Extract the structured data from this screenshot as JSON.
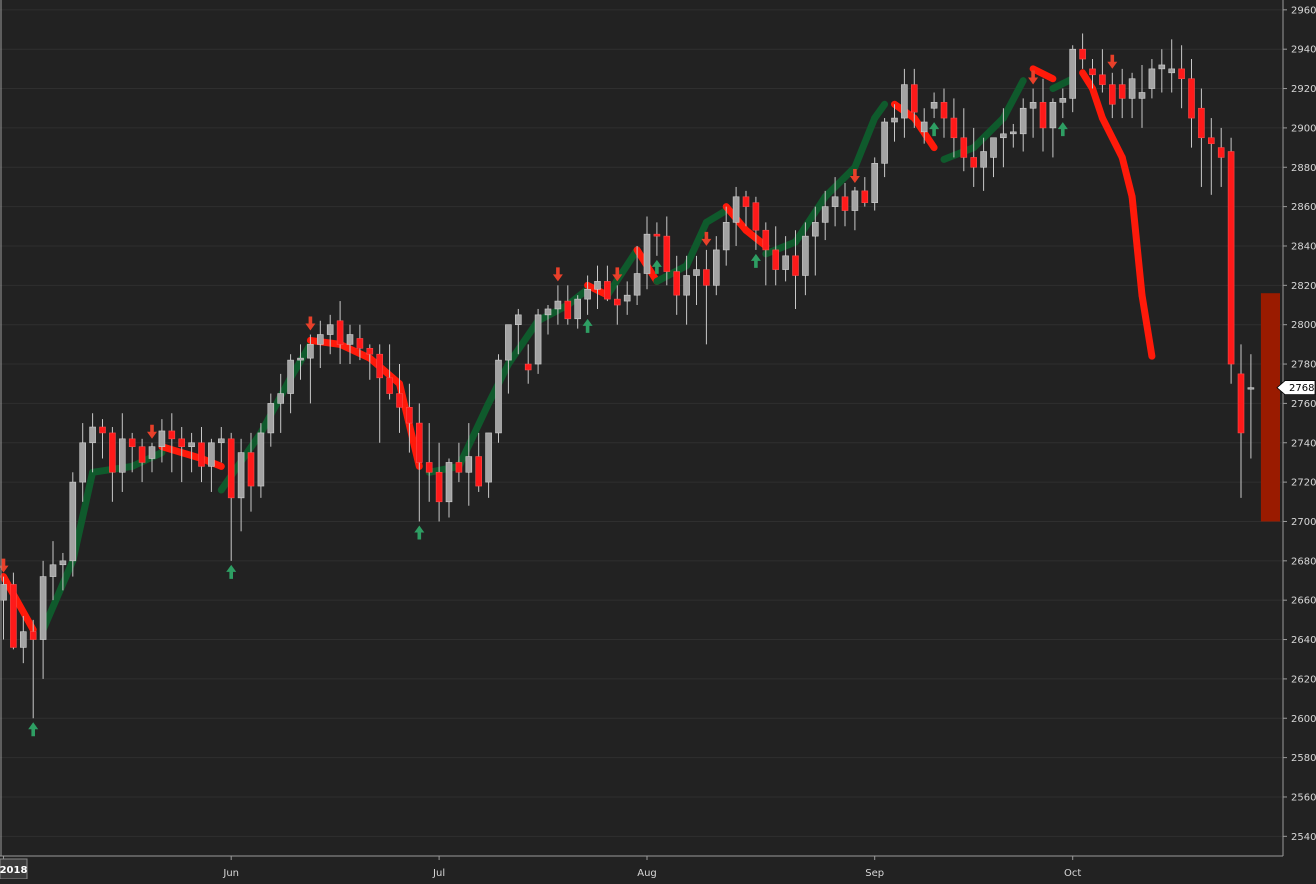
{
  "colors": {
    "background": "#222222",
    "grid": "#2f2f2f",
    "axis": "#9a9a9a",
    "label": "#d8d8d8",
    "up_candle": "#a3a3a3",
    "down_candle": "#ff1a1a",
    "trail_up": "#0f5a2c",
    "trail_down": "#ff1a0a",
    "arrow_up": "#2e9e63",
    "arrow_down": "#e8402a",
    "zone": "#9a1b00",
    "price_tag_bg": "#ffffff",
    "price_tag_text": "#000000"
  },
  "chart_data": {
    "type": "candlestick",
    "ylim": [
      2530,
      2965
    ],
    "y_ticks": [
      2540,
      2560,
      2580,
      2600,
      2620,
      2640,
      2660,
      2680,
      2700,
      2720,
      2740,
      2760,
      2780,
      2800,
      2820,
      2840,
      2860,
      2880,
      2900,
      2920,
      2940,
      2960
    ],
    "x_ticks": [
      {
        "label": "2018",
        "index": 0
      },
      {
        "label": "Jun",
        "index": 23
      },
      {
        "label": "Jul",
        "index": 44
      },
      {
        "label": "Aug",
        "index": 65
      },
      {
        "label": "Sep",
        "index": 88
      },
      {
        "label": "Oct",
        "index": 108
      }
    ],
    "last_price": "2768",
    "candles": [
      [
        2660,
        2672,
        2640,
        2668
      ],
      [
        2668,
        2674,
        2635,
        2636
      ],
      [
        2636,
        2652,
        2628,
        2644
      ],
      [
        2644,
        2650,
        2600,
        2640
      ],
      [
        2640,
        2680,
        2620,
        2672
      ],
      [
        2672,
        2690,
        2660,
        2678
      ],
      [
        2678,
        2684,
        2665,
        2680
      ],
      [
        2680,
        2725,
        2672,
        2720
      ],
      [
        2720,
        2750,
        2710,
        2740
      ],
      [
        2740,
        2755,
        2725,
        2748
      ],
      [
        2748,
        2752,
        2732,
        2745
      ],
      [
        2745,
        2748,
        2710,
        2725
      ],
      [
        2725,
        2755,
        2715,
        2742
      ],
      [
        2742,
        2745,
        2725,
        2738
      ],
      [
        2738,
        2742,
        2720,
        2730
      ],
      [
        2732,
        2740,
        2725,
        2738
      ],
      [
        2738,
        2752,
        2730,
        2746
      ],
      [
        2746,
        2755,
        2725,
        2742
      ],
      [
        2742,
        2748,
        2720,
        2738
      ],
      [
        2738,
        2745,
        2725,
        2740
      ],
      [
        2740,
        2748,
        2720,
        2728
      ],
      [
        2728,
        2742,
        2715,
        2740
      ],
      [
        2740,
        2748,
        2730,
        2742
      ],
      [
        2742,
        2745,
        2680,
        2712
      ],
      [
        2712,
        2742,
        2695,
        2735
      ],
      [
        2735,
        2745,
        2705,
        2718
      ],
      [
        2718,
        2750,
        2712,
        2745
      ],
      [
        2745,
        2765,
        2738,
        2760
      ],
      [
        2760,
        2775,
        2745,
        2765
      ],
      [
        2765,
        2785,
        2755,
        2782
      ],
      [
        2782,
        2790,
        2772,
        2783
      ],
      [
        2783,
        2795,
        2760,
        2790
      ],
      [
        2790,
        2802,
        2778,
        2795
      ],
      [
        2795,
        2805,
        2785,
        2800
      ],
      [
        2802,
        2812,
        2780,
        2790
      ],
      [
        2790,
        2800,
        2780,
        2795
      ],
      [
        2793,
        2800,
        2782,
        2788
      ],
      [
        2788,
        2790,
        2772,
        2785
      ],
      [
        2785,
        2790,
        2740,
        2773
      ],
      [
        2773,
        2790,
        2762,
        2765
      ],
      [
        2765,
        2780,
        2745,
        2758
      ],
      [
        2758,
        2770,
        2735,
        2750
      ],
      [
        2750,
        2760,
        2700,
        2730
      ],
      [
        2730,
        2750,
        2710,
        2725
      ],
      [
        2725,
        2740,
        2700,
        2710
      ],
      [
        2710,
        2732,
        2702,
        2730
      ],
      [
        2730,
        2740,
        2720,
        2725
      ],
      [
        2725,
        2750,
        2708,
        2733
      ],
      [
        2733,
        2745,
        2715,
        2718
      ],
      [
        2720,
        2745,
        2712,
        2745
      ],
      [
        2745,
        2785,
        2740,
        2782
      ],
      [
        2782,
        2800,
        2765,
        2800
      ],
      [
        2800,
        2808,
        2785,
        2805
      ],
      [
        2780,
        2790,
        2770,
        2777
      ],
      [
        2780,
        2808,
        2775,
        2805
      ],
      [
        2805,
        2810,
        2795,
        2808
      ],
      [
        2808,
        2820,
        2800,
        2812
      ],
      [
        2812,
        2820,
        2800,
        2803
      ],
      [
        2803,
        2815,
        2798,
        2813
      ],
      [
        2813,
        2825,
        2805,
        2818
      ],
      [
        2818,
        2830,
        2808,
        2822
      ],
      [
        2822,
        2830,
        2812,
        2813
      ],
      [
        2813,
        2820,
        2800,
        2810
      ],
      [
        2812,
        2822,
        2805,
        2815
      ],
      [
        2815,
        2840,
        2810,
        2826
      ],
      [
        2826,
        2855,
        2818,
        2846
      ],
      [
        2846,
        2852,
        2835,
        2845
      ],
      [
        2845,
        2855,
        2820,
        2827
      ],
      [
        2827,
        2835,
        2805,
        2815
      ],
      [
        2815,
        2835,
        2800,
        2825
      ],
      [
        2825,
        2835,
        2810,
        2828
      ],
      [
        2828,
        2838,
        2790,
        2820
      ],
      [
        2820,
        2845,
        2815,
        2838
      ],
      [
        2838,
        2860,
        2830,
        2852
      ],
      [
        2852,
        2870,
        2840,
        2865
      ],
      [
        2865,
        2868,
        2850,
        2860
      ],
      [
        2862,
        2865,
        2838,
        2848
      ],
      [
        2848,
        2852,
        2820,
        2838
      ],
      [
        2838,
        2850,
        2820,
        2828
      ],
      [
        2828,
        2845,
        2822,
        2835
      ],
      [
        2835,
        2848,
        2808,
        2825
      ],
      [
        2825,
        2852,
        2815,
        2845
      ],
      [
        2845,
        2860,
        2825,
        2852
      ],
      [
        2852,
        2868,
        2843,
        2860
      ],
      [
        2860,
        2875,
        2850,
        2865
      ],
      [
        2865,
        2872,
        2850,
        2858
      ],
      [
        2858,
        2870,
        2848,
        2868
      ],
      [
        2868,
        2875,
        2860,
        2862
      ],
      [
        2862,
        2885,
        2858,
        2882
      ],
      [
        2882,
        2905,
        2875,
        2903
      ],
      [
        2903,
        2912,
        2893,
        2905
      ],
      [
        2905,
        2930,
        2895,
        2922
      ],
      [
        2922,
        2930,
        2900,
        2908
      ],
      [
        2898,
        2910,
        2892,
        2903
      ],
      [
        2910,
        2918,
        2905,
        2913
      ],
      [
        2913,
        2920,
        2895,
        2905
      ],
      [
        2905,
        2915,
        2885,
        2895
      ],
      [
        2895,
        2910,
        2878,
        2885
      ],
      [
        2885,
        2900,
        2870,
        2880
      ],
      [
        2880,
        2895,
        2868,
        2888
      ],
      [
        2885,
        2895,
        2875,
        2895
      ],
      [
        2895,
        2910,
        2880,
        2897
      ],
      [
        2897,
        2902,
        2890,
        2898
      ],
      [
        2897,
        2915,
        2888,
        2910
      ],
      [
        2910,
        2920,
        2895,
        2913
      ],
      [
        2913,
        2925,
        2888,
        2900
      ],
      [
        2900,
        2915,
        2885,
        2913
      ],
      [
        2913,
        2920,
        2905,
        2915
      ],
      [
        2915,
        2942,
        2908,
        2940
      ],
      [
        2940,
        2948,
        2930,
        2935
      ],
      [
        2930,
        2935,
        2920,
        2927
      ],
      [
        2927,
        2940,
        2918,
        2922
      ],
      [
        2922,
        2928,
        2905,
        2912
      ],
      [
        2922,
        2930,
        2905,
        2915
      ],
      [
        2915,
        2928,
        2905,
        2925
      ],
      [
        2915,
        2932,
        2900,
        2918
      ],
      [
        2920,
        2935,
        2915,
        2930
      ],
      [
        2930,
        2940,
        2918,
        2932
      ],
      [
        2928,
        2945,
        2918,
        2930
      ],
      [
        2930,
        2942,
        2910,
        2925
      ],
      [
        2925,
        2935,
        2890,
        2905
      ],
      [
        2910,
        2920,
        2870,
        2895
      ],
      [
        2895,
        2905,
        2866,
        2892
      ],
      [
        2890,
        2900,
        2870,
        2885
      ],
      [
        2888,
        2895,
        2770,
        2780
      ],
      [
        2775,
        2790,
        2712,
        2745
      ],
      [
        2768,
        2785,
        2732,
        2768
      ]
    ],
    "trail_stop": [
      {
        "x": 0,
        "y": 2672,
        "dir": "down"
      },
      {
        "x": 3,
        "y": 2645,
        "dir": "down"
      },
      {
        "x": 4,
        "y": 2645,
        "dir": "up"
      },
      {
        "x": 7,
        "y": 2680,
        "dir": "up"
      },
      {
        "x": 9,
        "y": 2725,
        "dir": "up"
      },
      {
        "x": 13,
        "y": 2728,
        "dir": "up"
      },
      {
        "x": 16,
        "y": 2735,
        "dir": "up"
      },
      {
        "x": 16,
        "y": 2738,
        "dir": "down"
      },
      {
        "x": 20,
        "y": 2732,
        "dir": "down"
      },
      {
        "x": 22,
        "y": 2728,
        "dir": "down"
      },
      {
        "x": 22,
        "y": 2716,
        "dir": "up"
      },
      {
        "x": 26,
        "y": 2745,
        "dir": "up"
      },
      {
        "x": 29,
        "y": 2773,
        "dir": "up"
      },
      {
        "x": 31,
        "y": 2790,
        "dir": "up"
      },
      {
        "x": 31,
        "y": 2792,
        "dir": "down"
      },
      {
        "x": 34,
        "y": 2790,
        "dir": "down"
      },
      {
        "x": 37,
        "y": 2783,
        "dir": "down"
      },
      {
        "x": 40,
        "y": 2770,
        "dir": "down"
      },
      {
        "x": 42,
        "y": 2728,
        "dir": "down"
      },
      {
        "x": 43,
        "y": 2725,
        "dir": "up"
      },
      {
        "x": 46,
        "y": 2728,
        "dir": "up"
      },
      {
        "x": 49,
        "y": 2760,
        "dir": "up"
      },
      {
        "x": 51,
        "y": 2780,
        "dir": "up"
      },
      {
        "x": 54,
        "y": 2802,
        "dir": "up"
      },
      {
        "x": 57,
        "y": 2810,
        "dir": "up"
      },
      {
        "x": 59,
        "y": 2818,
        "dir": "up"
      },
      {
        "x": 59,
        "y": 2820,
        "dir": "down"
      },
      {
        "x": 61,
        "y": 2815,
        "dir": "down"
      },
      {
        "x": 61,
        "y": 2815,
        "dir": "up"
      },
      {
        "x": 64,
        "y": 2838,
        "dir": "up"
      },
      {
        "x": 64,
        "y": 2838,
        "dir": "down"
      },
      {
        "x": 66,
        "y": 2822,
        "dir": "down"
      },
      {
        "x": 66,
        "y": 2822,
        "dir": "up"
      },
      {
        "x": 69,
        "y": 2830,
        "dir": "up"
      },
      {
        "x": 71,
        "y": 2852,
        "dir": "up"
      },
      {
        "x": 73,
        "y": 2858,
        "dir": "up"
      },
      {
        "x": 73,
        "y": 2860,
        "dir": "down"
      },
      {
        "x": 75,
        "y": 2848,
        "dir": "down"
      },
      {
        "x": 77,
        "y": 2840,
        "dir": "down"
      },
      {
        "x": 77,
        "y": 2836,
        "dir": "up"
      },
      {
        "x": 80,
        "y": 2842,
        "dir": "up"
      },
      {
        "x": 83,
        "y": 2865,
        "dir": "up"
      },
      {
        "x": 86,
        "y": 2880,
        "dir": "up"
      },
      {
        "x": 88,
        "y": 2905,
        "dir": "up"
      },
      {
        "x": 89,
        "y": 2912,
        "dir": "up"
      },
      {
        "x": 90,
        "y": 2912,
        "dir": "down"
      },
      {
        "x": 92,
        "y": 2905,
        "dir": "down"
      },
      {
        "x": 94,
        "y": 2890,
        "dir": "down"
      },
      {
        "x": 95,
        "y": 2884,
        "dir": "up"
      },
      {
        "x": 98,
        "y": 2890,
        "dir": "up"
      },
      {
        "x": 101,
        "y": 2905,
        "dir": "up"
      },
      {
        "x": 103,
        "y": 2924,
        "dir": "up"
      },
      {
        "x": 104,
        "y": 2930,
        "dir": "down"
      },
      {
        "x": 106,
        "y": 2925,
        "dir": "down"
      },
      {
        "x": 106,
        "y": 2920,
        "dir": "up"
      },
      {
        "x": 108,
        "y": 2925,
        "dir": "up"
      },
      {
        "x": 109,
        "y": 2928,
        "dir": "down"
      },
      {
        "x": 110,
        "y": 2920,
        "dir": "down"
      },
      {
        "x": 111,
        "y": 2905,
        "dir": "down"
      },
      {
        "x": 113,
        "y": 2885,
        "dir": "down"
      },
      {
        "x": 114,
        "y": 2865,
        "dir": "down"
      },
      {
        "x": 115,
        "y": 2815,
        "dir": "down"
      },
      {
        "x": 116,
        "y": 2784,
        "dir": "down"
      }
    ],
    "signals": [
      {
        "i": 0,
        "type": "down"
      },
      {
        "i": 3,
        "type": "up"
      },
      {
        "i": 15,
        "type": "down"
      },
      {
        "i": 23,
        "type": "up"
      },
      {
        "i": 31,
        "type": "down"
      },
      {
        "i": 42,
        "type": "up"
      },
      {
        "i": 56,
        "type": "down"
      },
      {
        "i": 59,
        "type": "up"
      },
      {
        "i": 62,
        "type": "down"
      },
      {
        "i": 66,
        "type": "up"
      },
      {
        "i": 71,
        "type": "down"
      },
      {
        "i": 76,
        "type": "up"
      },
      {
        "i": 86,
        "type": "down"
      },
      {
        "i": 94,
        "type": "up"
      },
      {
        "i": 104,
        "type": "down"
      },
      {
        "i": 107,
        "type": "up"
      },
      {
        "i": 112,
        "type": "down"
      }
    ],
    "zone": {
      "y_top": 2816,
      "y_bottom": 2700
    }
  }
}
